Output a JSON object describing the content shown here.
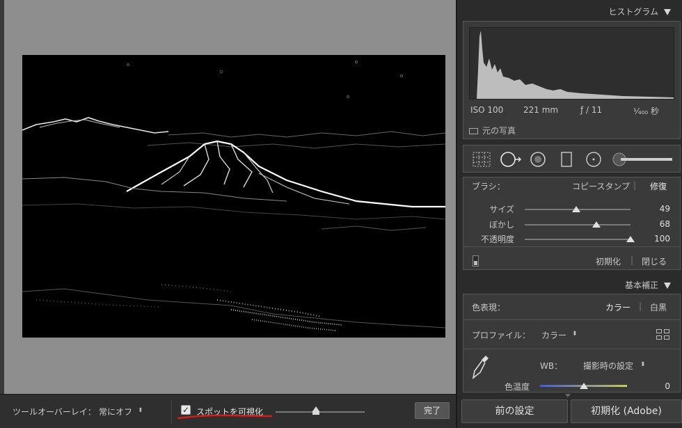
{
  "toolbar": {
    "overlay_label": "ツールオーバーレイ：",
    "overlay_value": "常にオフ",
    "overlay_arrows": "⬍",
    "visualize_check": "✓",
    "visualize_label": "スポットを可視化",
    "visualize_level": 0.45,
    "done_label": "完了"
  },
  "histogram": {
    "header": "ヒストグラム",
    "iso": "ISO 100",
    "focal": "221 mm",
    "aperture": "ƒ / 11",
    "shutter": "¹⁄₄₀₀ 秒",
    "original_photo": "元の写真"
  },
  "brush": {
    "label": "ブラシ：",
    "mode_clone": "コピースタンプ",
    "sep": "|",
    "mode_heal": "修復",
    "sliders": [
      {
        "label": "サイズ",
        "value": "49",
        "level": 0.49
      },
      {
        "label": "ぼかし",
        "value": "68",
        "level": 0.68
      },
      {
        "label": "不透明度",
        "value": "100",
        "level": 1.0
      }
    ],
    "reset": "初期化",
    "close": "閉じる"
  },
  "basic": {
    "header": "基本補正",
    "treatment_label": "色表現：",
    "treatment_color": "カラー",
    "treatment_bw": "白黒",
    "profile_label": "プロファイル：",
    "profile_value": "カラー",
    "profile_arrows": "⬍",
    "wb_label": "WB：",
    "wb_value": "撮影時の設定",
    "wb_arrows": "⬍",
    "temp_label": "色温度",
    "temp_value": "0",
    "temp_level": 0.5
  },
  "buttons": {
    "previous": "前の設定",
    "reset_adobe": "初期化 (Adobe)"
  }
}
